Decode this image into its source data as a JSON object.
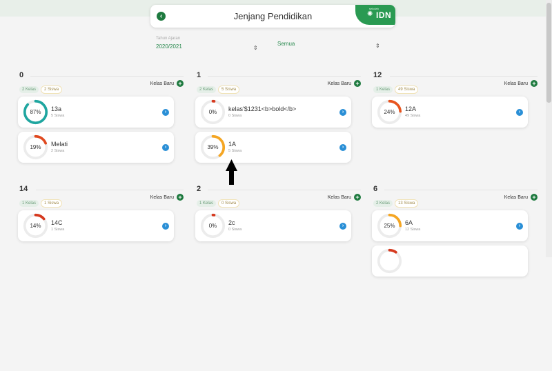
{
  "header": {
    "title": "Jenjang Pendidikan",
    "back_icon": "‹",
    "logo_small": "sekolah",
    "logo_text": "IDN"
  },
  "filters": {
    "year_label": "Tahun Ajaran",
    "year_value": "2020/2021",
    "scope_value": "Semua"
  },
  "groups": [
    {
      "title": "0",
      "kelas": "2 Kelas",
      "siswa": "2 Siswa",
      "add_label": "Kelas Baru",
      "cards": [
        {
          "pct": "87%",
          "pct_value": 87,
          "color": "#1fa6a0",
          "name": "13a",
          "sub": "5 Siswa"
        },
        {
          "pct": "19%",
          "pct_value": 19,
          "color": "#e0491f",
          "name": "Melati",
          "sub": "2 Siswa"
        }
      ]
    },
    {
      "title": "1",
      "kelas": "2 Kelas",
      "siswa": "5 Siswa",
      "add_label": "Kelas Baru",
      "cards": [
        {
          "pct": "0%",
          "pct_value": 0,
          "color": "#d63a1f",
          "name": "kelas'$1231<b>bold</b>",
          "sub": "0 Siswa"
        },
        {
          "pct": "39%",
          "pct_value": 39,
          "color": "#f5a623",
          "name": "1A",
          "sub": "5 Siswa"
        }
      ]
    },
    {
      "title": "12",
      "kelas": "1 Kelas",
      "siswa": "49 Siswa",
      "add_label": "Kelas Baru",
      "cards": [
        {
          "pct": "24%",
          "pct_value": 24,
          "color": "#e8541e",
          "name": "12A",
          "sub": "49 Siswa"
        }
      ]
    },
    {
      "title": "14",
      "kelas": "1 Kelas",
      "siswa": "1 Siswa",
      "add_label": "Kelas Baru",
      "cards": [
        {
          "pct": "14%",
          "pct_value": 14,
          "color": "#d63a1f",
          "name": "14C",
          "sub": "1 Siswa"
        }
      ]
    },
    {
      "title": "2",
      "kelas": "1 Kelas",
      "siswa": "0 Siswa",
      "add_label": "Kelas Baru",
      "cards": [
        {
          "pct": "0%",
          "pct_value": 0,
          "color": "#d63a1f",
          "name": "2c",
          "sub": "0 Siswa"
        }
      ]
    },
    {
      "title": "6",
      "kelas": "2 Kelas",
      "siswa": "13 Siswa",
      "add_label": "Kelas Baru",
      "cards": [
        {
          "pct": "25%",
          "pct_value": 25,
          "color": "#f5a623",
          "name": "6A",
          "sub": "12 Siswa"
        },
        {
          "pct": "",
          "pct_value": 10,
          "color": "#d63a1f",
          "name": "",
          "sub": ""
        }
      ]
    }
  ]
}
